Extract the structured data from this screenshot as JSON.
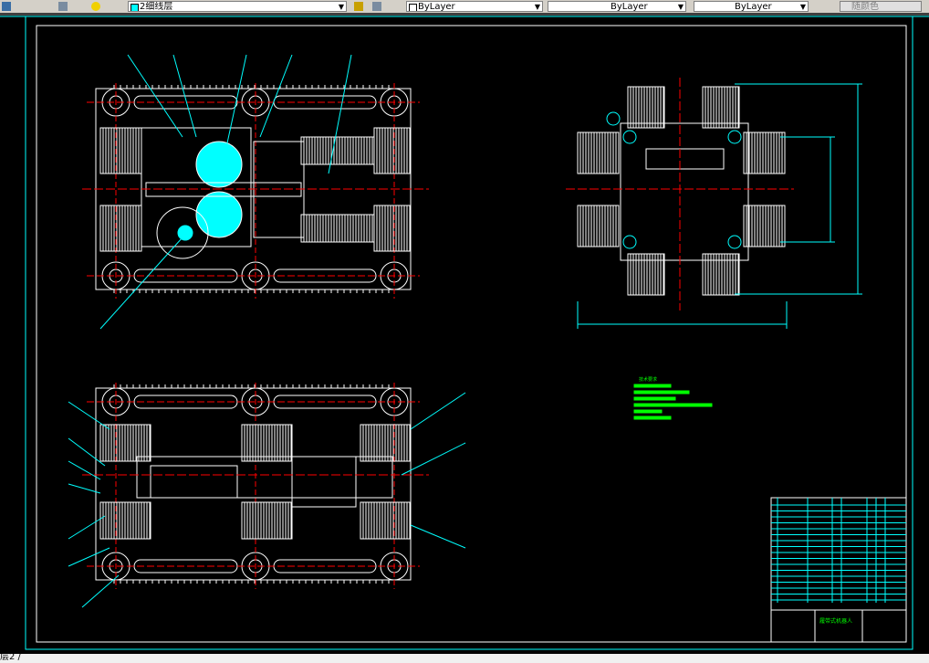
{
  "toolbar": {
    "layer_name": "2细线层",
    "color": "ByLayer",
    "linetype": "ByLayer",
    "lineweight": "ByLayer",
    "plot_style": "随颜色",
    "layer_color": "#00ffff"
  },
  "status": {
    "command_text": "层2 /"
  },
  "colors": {
    "background": "#000000",
    "frame": "#ffffff",
    "outer_frame": "#00ffff",
    "centerline": "#ff0000",
    "part": "#ffffff",
    "hatch": "#00ffff",
    "text": "#00ff00"
  },
  "drawing": {
    "views": [
      "top-view",
      "side-view",
      "end-view"
    ],
    "notes_title": "技术要求",
    "title_block_name": "履带式机器人"
  }
}
